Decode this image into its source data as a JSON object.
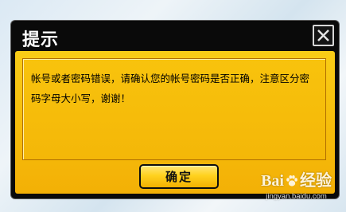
{
  "dialog": {
    "title": "提示",
    "close_icon": "close-icon",
    "message": "帐号或者密码错误，请确认您的帐号密码是否正确，注意区分密码字母大小写，谢谢！",
    "ok_label": "确定"
  },
  "watermark": {
    "brand": "Bai",
    "brand_suffix": "经验",
    "url": "jingyan.baidu.com"
  },
  "colors": {
    "panel": "#f6bf0c",
    "frame": "#0a0a0a",
    "button": "#ffd21f"
  }
}
